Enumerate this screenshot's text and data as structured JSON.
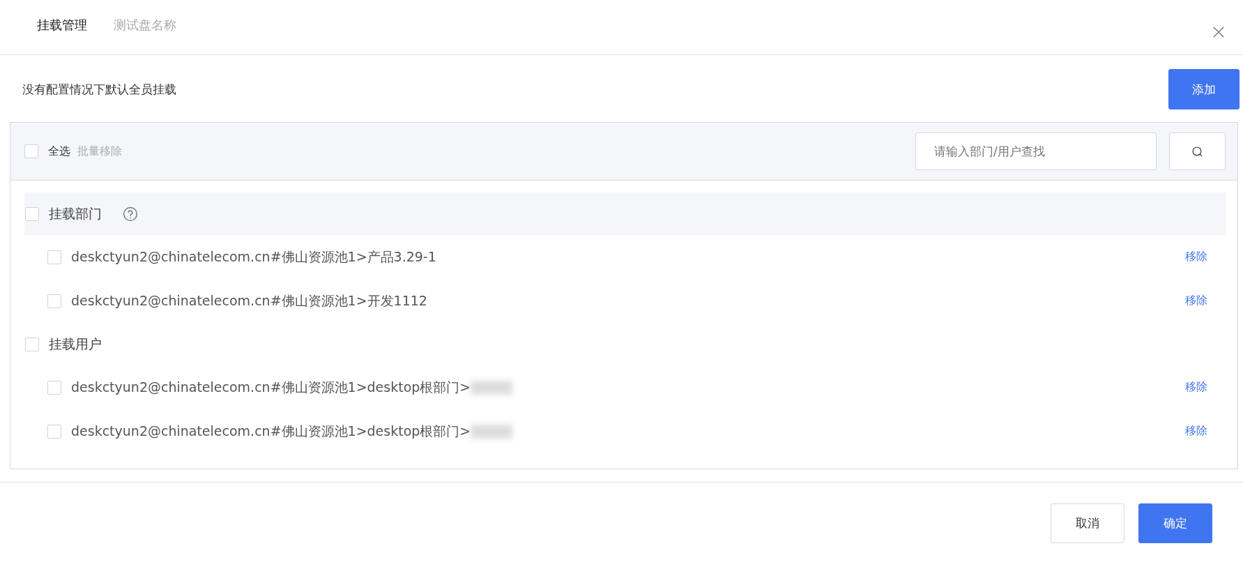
{
  "tabs": [
    {
      "label": "挂载管理",
      "selected": true
    },
    {
      "label": "测试盘名称",
      "selected": false
    }
  ],
  "description": "没有配置情况下默认全员挂载",
  "add_button": "添加",
  "toolbar": {
    "select_all": {
      "label": "全选",
      "checked": false
    },
    "batch_remove": "批量移除",
    "search": {
      "placeholder": "请输入部门/用户查找"
    }
  },
  "groups": [
    {
      "label": "挂载部门",
      "checked": false,
      "help": true,
      "items": [
        {
          "text": "deskctyun2@chinatelecom.cn#佛山资源池1>产品3.29-1",
          "checked": false,
          "redacted_tail": false,
          "action": "移除"
        },
        {
          "text": "deskctyun2@chinatelecom.cn#佛山资源池1>开发1112",
          "checked": false,
          "redacted_tail": false,
          "action": "移除"
        }
      ]
    },
    {
      "label": "挂载用户",
      "checked": false,
      "help": false,
      "items": [
        {
          "text": "deskctyun2@chinatelecom.cn#佛山资源池1>desktop根部门>",
          "checked": false,
          "redacted_tail": true,
          "action": "移除"
        },
        {
          "text": "deskctyun2@chinatelecom.cn#佛山资源池1>desktop根部门>",
          "checked": false,
          "redacted_tail": true,
          "action": "移除"
        }
      ]
    }
  ],
  "footer": {
    "cancel": "取消",
    "confirm": "确定"
  }
}
